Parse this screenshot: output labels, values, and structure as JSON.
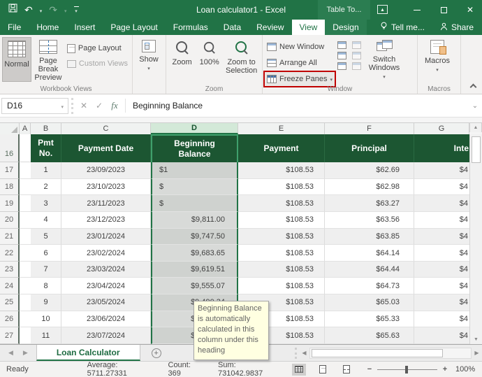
{
  "title_bar": {
    "title": "Loan calculator1 - Excel",
    "contextual_group": "Table To..."
  },
  "tabs": {
    "items": [
      "File",
      "Home",
      "Insert",
      "Page Layout",
      "Formulas",
      "Data",
      "Review",
      "View",
      "Design"
    ],
    "active": "View",
    "tell_me": "Tell me...",
    "share": "Share"
  },
  "ribbon": {
    "workbook_views": {
      "normal": "Normal",
      "page_break_preview": "Page Break Preview",
      "page_layout": "Page Layout",
      "custom_views": "Custom Views",
      "group_label": "Workbook Views"
    },
    "show": {
      "label": "Show"
    },
    "zoom": {
      "zoom": "Zoom",
      "hundred": "100%",
      "zoom_to_selection": "Zoom to Selection",
      "group_label": "Zoom"
    },
    "window": {
      "new_window": "New Window",
      "arrange_all": "Arrange All",
      "freeze_panes": "Freeze Panes",
      "switch_windows": "Switch Windows",
      "group_label": "Window"
    },
    "macros": {
      "button": "Macros",
      "group_label": "Macros"
    }
  },
  "formula_bar": {
    "name_box": "D16",
    "value": "Beginning Balance"
  },
  "sheet": {
    "column_headers": [
      "A",
      "B",
      "C",
      "D",
      "E",
      "F",
      "G"
    ],
    "selected_column": "D",
    "header_row_number": "16",
    "header": {
      "pmt": "Pmt No.",
      "date": "Payment Date",
      "balance": "Beginning Balance",
      "payment": "Payment",
      "principal": "Principal",
      "interest": "Inte"
    },
    "rows": [
      {
        "n": "17",
        "pmt": "1",
        "date": "23/09/2023",
        "balance": "$1",
        "payment": "$108.53",
        "principal": "$62.69",
        "interest": "$4",
        "banded": true,
        "balance_fragment": true
      },
      {
        "n": "18",
        "pmt": "2",
        "date": "23/10/2023",
        "balance": "$",
        "payment": "$108.53",
        "principal": "$62.98",
        "interest": "$4",
        "banded": false,
        "balance_fragment": true
      },
      {
        "n": "19",
        "pmt": "3",
        "date": "23/11/2023",
        "balance": "$",
        "payment": "$108.53",
        "principal": "$63.27",
        "interest": "$4",
        "banded": true,
        "balance_fragment": true
      },
      {
        "n": "20",
        "pmt": "4",
        "date": "23/12/2023",
        "balance": "$9,811.00",
        "payment": "$108.53",
        "principal": "$63.56",
        "interest": "$4",
        "banded": false,
        "balance_fragment": false
      },
      {
        "n": "21",
        "pmt": "5",
        "date": "23/01/2024",
        "balance": "$9,747.50",
        "payment": "$108.53",
        "principal": "$63.85",
        "interest": "$4",
        "banded": true,
        "balance_fragment": false
      },
      {
        "n": "22",
        "pmt": "6",
        "date": "23/02/2024",
        "balance": "$9,683.65",
        "payment": "$108.53",
        "principal": "$64.14",
        "interest": "$4",
        "banded": false,
        "balance_fragment": false
      },
      {
        "n": "23",
        "pmt": "7",
        "date": "23/03/2024",
        "balance": "$9,619.51",
        "payment": "$108.53",
        "principal": "$64.44",
        "interest": "$4",
        "banded": true,
        "balance_fragment": false
      },
      {
        "n": "24",
        "pmt": "8",
        "date": "23/04/2024",
        "balance": "$9,555.07",
        "payment": "$108.53",
        "principal": "$64.73",
        "interest": "$4",
        "banded": false,
        "balance_fragment": false
      },
      {
        "n": "25",
        "pmt": "9",
        "date": "23/05/2024",
        "balance": "$9,490.34",
        "payment": "$108.53",
        "principal": "$65.03",
        "interest": "$4",
        "banded": true,
        "balance_fragment": false
      },
      {
        "n": "26",
        "pmt": "10",
        "date": "23/06/2024",
        "balance": "$9,425.31",
        "payment": "$108.53",
        "principal": "$65.33",
        "interest": "$4",
        "banded": false,
        "balance_fragment": false
      },
      {
        "n": "27",
        "pmt": "11",
        "date": "23/07/2024",
        "balance": "$9,359.98",
        "payment": "$108.53",
        "principal": "$65.63",
        "interest": "$4",
        "banded": true,
        "balance_fragment": false
      }
    ]
  },
  "tooltip": {
    "text": "Beginning Balance is automatically calculated in this column under this heading"
  },
  "sheet_tabs": {
    "active": "Loan Calculator"
  },
  "status_bar": {
    "mode": "Ready",
    "average": "Average: 5711.27331",
    "count": "Count: 369",
    "sum": "Sum: 731042.9837",
    "zoom_level": "100%"
  },
  "colors": {
    "excel_green": "#217346",
    "table_header_green": "#1c5632",
    "highlight_red": "#c00000",
    "tooltip_yellow": "#ffffe1"
  }
}
